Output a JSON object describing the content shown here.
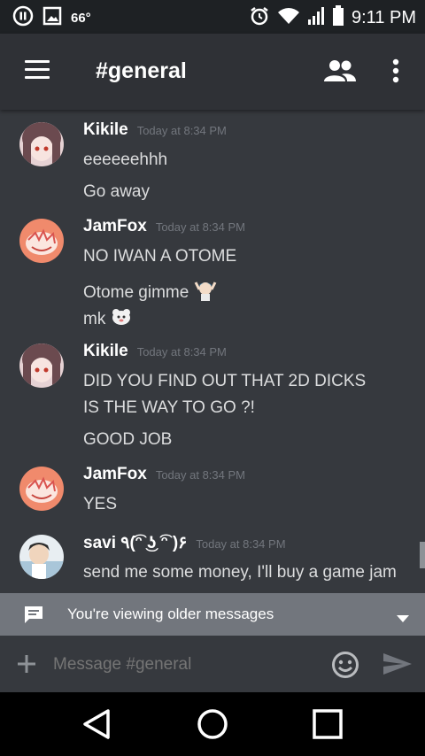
{
  "status_bar": {
    "temperature": "66°",
    "time": "9:11 PM"
  },
  "header": {
    "channel_title": "#general"
  },
  "messages": [
    {
      "author": "Kikile",
      "timestamp": "Today at 8:34 PM",
      "avatar_color": "#6b4a4f",
      "lines": [
        "eeeeeehhh",
        "Go away"
      ]
    },
    {
      "author": "JamFox",
      "timestamp": "Today at 8:34 PM",
      "avatar_color": "#f08a6c",
      "lines": [
        "NO IWAN A OTOME",
        "Otome gimme",
        "mk"
      ]
    },
    {
      "author": "Kikile",
      "timestamp": "Today at 8:34 PM",
      "avatar_color": "#6b4a4f",
      "lines": [
        "DID  YOU FIND OUT THAT 2D DICKS",
        "IS THE WAY TO GO ?!",
        "GOOD JOB"
      ]
    },
    {
      "author": "JamFox",
      "timestamp": "Today at 8:34 PM",
      "avatar_color": "#f08a6c",
      "lines": [
        "YES"
      ]
    },
    {
      "author": "savi ٩(͡ᵔ ͜ʖ ͡ᵔ )۶",
      "timestamp": "Today at 8:34 PM",
      "avatar_color": "#cfd8dc",
      "lines": [
        "send me some money, I'll buy a game jam"
      ]
    }
  ],
  "older_notice": {
    "text": "You're viewing older messages"
  },
  "composer": {
    "placeholder": "Message #general"
  },
  "colors": {
    "background": "#36393e",
    "appbar": "#2f3136",
    "notice": "#72767d"
  }
}
